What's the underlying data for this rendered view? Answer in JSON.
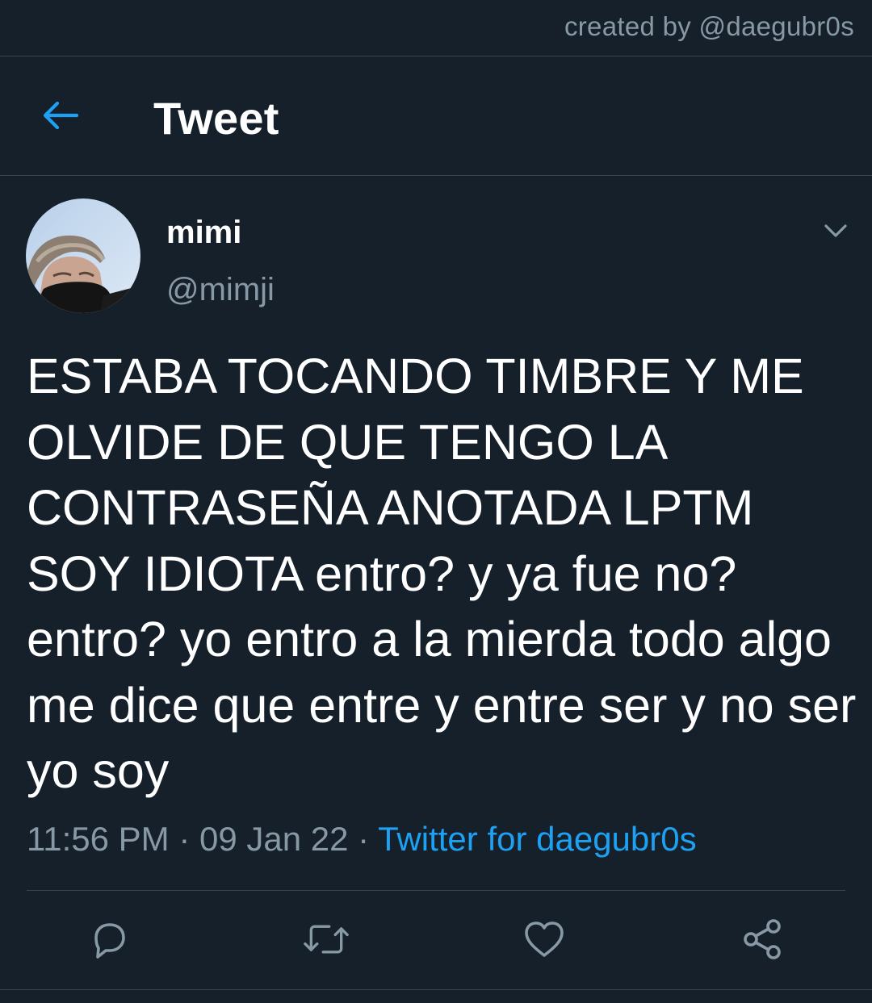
{
  "watermark": "created by @daegubr0s",
  "header": {
    "title": "Tweet",
    "back_icon": "arrow-left-icon"
  },
  "tweet": {
    "display_name": "mimi",
    "handle": "@mimji",
    "text": "ESTABA TOCANDO TIMBRE Y ME OLVIDE DE QUE TENGO LA CONTRASEÑA ANOTADA LPTM SOY IDIOTA entro? y ya fue no? entro? yo entro a la mierda todo algo me dice que entre y entre ser y no ser yo soy",
    "time": "11:56 PM",
    "date": "09 Jan 22",
    "separator": "·",
    "source": "Twitter for daegubr0s"
  },
  "actions": [
    "reply-icon",
    "retweet-icon",
    "like-icon",
    "share-icon"
  ],
  "colors": {
    "background": "#15202b",
    "accent": "#1da1f2",
    "secondary_text": "#8899a6",
    "divider": "#38444d"
  }
}
